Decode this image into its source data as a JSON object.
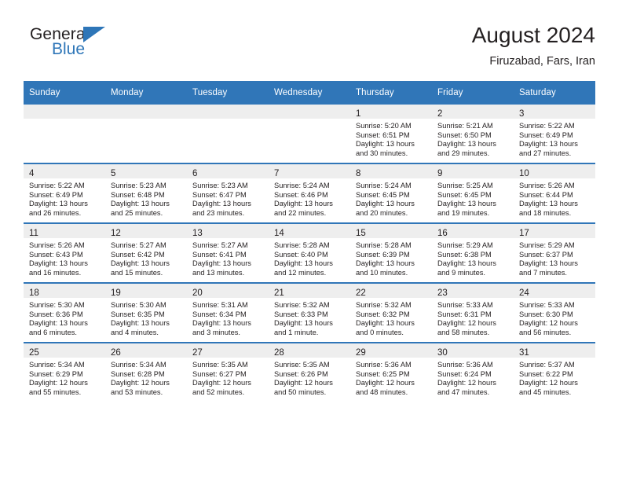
{
  "brand": {
    "word_one": "General",
    "word_two": "Blue",
    "flag_icon": "triangle-flag-icon"
  },
  "header": {
    "month_title": "August 2024",
    "location": "Firuzabad, Fars, Iran"
  },
  "colors": {
    "header_blue": "#3076b8",
    "brand_blue": "#2e76b8",
    "daynum_strip": "#eeeeee",
    "text": "#231f20"
  },
  "calendar": {
    "weekday_headers": [
      "Sunday",
      "Monday",
      "Tuesday",
      "Wednesday",
      "Thursday",
      "Friday",
      "Saturday"
    ],
    "weeks": [
      [
        {
          "day": "",
          "sunrise": "",
          "sunset": "",
          "daylight_line1": "",
          "daylight_line2": ""
        },
        {
          "day": "",
          "sunrise": "",
          "sunset": "",
          "daylight_line1": "",
          "daylight_line2": ""
        },
        {
          "day": "",
          "sunrise": "",
          "sunset": "",
          "daylight_line1": "",
          "daylight_line2": ""
        },
        {
          "day": "",
          "sunrise": "",
          "sunset": "",
          "daylight_line1": "",
          "daylight_line2": ""
        },
        {
          "day": "1",
          "sunrise": "Sunrise: 5:20 AM",
          "sunset": "Sunset: 6:51 PM",
          "daylight_line1": "Daylight: 13 hours",
          "daylight_line2": "and 30 minutes."
        },
        {
          "day": "2",
          "sunrise": "Sunrise: 5:21 AM",
          "sunset": "Sunset: 6:50 PM",
          "daylight_line1": "Daylight: 13 hours",
          "daylight_line2": "and 29 minutes."
        },
        {
          "day": "3",
          "sunrise": "Sunrise: 5:22 AM",
          "sunset": "Sunset: 6:49 PM",
          "daylight_line1": "Daylight: 13 hours",
          "daylight_line2": "and 27 minutes."
        }
      ],
      [
        {
          "day": "4",
          "sunrise": "Sunrise: 5:22 AM",
          "sunset": "Sunset: 6:49 PM",
          "daylight_line1": "Daylight: 13 hours",
          "daylight_line2": "and 26 minutes."
        },
        {
          "day": "5",
          "sunrise": "Sunrise: 5:23 AM",
          "sunset": "Sunset: 6:48 PM",
          "daylight_line1": "Daylight: 13 hours",
          "daylight_line2": "and 25 minutes."
        },
        {
          "day": "6",
          "sunrise": "Sunrise: 5:23 AM",
          "sunset": "Sunset: 6:47 PM",
          "daylight_line1": "Daylight: 13 hours",
          "daylight_line2": "and 23 minutes."
        },
        {
          "day": "7",
          "sunrise": "Sunrise: 5:24 AM",
          "sunset": "Sunset: 6:46 PM",
          "daylight_line1": "Daylight: 13 hours",
          "daylight_line2": "and 22 minutes."
        },
        {
          "day": "8",
          "sunrise": "Sunrise: 5:24 AM",
          "sunset": "Sunset: 6:45 PM",
          "daylight_line1": "Daylight: 13 hours",
          "daylight_line2": "and 20 minutes."
        },
        {
          "day": "9",
          "sunrise": "Sunrise: 5:25 AM",
          "sunset": "Sunset: 6:45 PM",
          "daylight_line1": "Daylight: 13 hours",
          "daylight_line2": "and 19 minutes."
        },
        {
          "day": "10",
          "sunrise": "Sunrise: 5:26 AM",
          "sunset": "Sunset: 6:44 PM",
          "daylight_line1": "Daylight: 13 hours",
          "daylight_line2": "and 18 minutes."
        }
      ],
      [
        {
          "day": "11",
          "sunrise": "Sunrise: 5:26 AM",
          "sunset": "Sunset: 6:43 PM",
          "daylight_line1": "Daylight: 13 hours",
          "daylight_line2": "and 16 minutes."
        },
        {
          "day": "12",
          "sunrise": "Sunrise: 5:27 AM",
          "sunset": "Sunset: 6:42 PM",
          "daylight_line1": "Daylight: 13 hours",
          "daylight_line2": "and 15 minutes."
        },
        {
          "day": "13",
          "sunrise": "Sunrise: 5:27 AM",
          "sunset": "Sunset: 6:41 PM",
          "daylight_line1": "Daylight: 13 hours",
          "daylight_line2": "and 13 minutes."
        },
        {
          "day": "14",
          "sunrise": "Sunrise: 5:28 AM",
          "sunset": "Sunset: 6:40 PM",
          "daylight_line1": "Daylight: 13 hours",
          "daylight_line2": "and 12 minutes."
        },
        {
          "day": "15",
          "sunrise": "Sunrise: 5:28 AM",
          "sunset": "Sunset: 6:39 PM",
          "daylight_line1": "Daylight: 13 hours",
          "daylight_line2": "and 10 minutes."
        },
        {
          "day": "16",
          "sunrise": "Sunrise: 5:29 AM",
          "sunset": "Sunset: 6:38 PM",
          "daylight_line1": "Daylight: 13 hours",
          "daylight_line2": "and 9 minutes."
        },
        {
          "day": "17",
          "sunrise": "Sunrise: 5:29 AM",
          "sunset": "Sunset: 6:37 PM",
          "daylight_line1": "Daylight: 13 hours",
          "daylight_line2": "and 7 minutes."
        }
      ],
      [
        {
          "day": "18",
          "sunrise": "Sunrise: 5:30 AM",
          "sunset": "Sunset: 6:36 PM",
          "daylight_line1": "Daylight: 13 hours",
          "daylight_line2": "and 6 minutes."
        },
        {
          "day": "19",
          "sunrise": "Sunrise: 5:30 AM",
          "sunset": "Sunset: 6:35 PM",
          "daylight_line1": "Daylight: 13 hours",
          "daylight_line2": "and 4 minutes."
        },
        {
          "day": "20",
          "sunrise": "Sunrise: 5:31 AM",
          "sunset": "Sunset: 6:34 PM",
          "daylight_line1": "Daylight: 13 hours",
          "daylight_line2": "and 3 minutes."
        },
        {
          "day": "21",
          "sunrise": "Sunrise: 5:32 AM",
          "sunset": "Sunset: 6:33 PM",
          "daylight_line1": "Daylight: 13 hours",
          "daylight_line2": "and 1 minute."
        },
        {
          "day": "22",
          "sunrise": "Sunrise: 5:32 AM",
          "sunset": "Sunset: 6:32 PM",
          "daylight_line1": "Daylight: 13 hours",
          "daylight_line2": "and 0 minutes."
        },
        {
          "day": "23",
          "sunrise": "Sunrise: 5:33 AM",
          "sunset": "Sunset: 6:31 PM",
          "daylight_line1": "Daylight: 12 hours",
          "daylight_line2": "and 58 minutes."
        },
        {
          "day": "24",
          "sunrise": "Sunrise: 5:33 AM",
          "sunset": "Sunset: 6:30 PM",
          "daylight_line1": "Daylight: 12 hours",
          "daylight_line2": "and 56 minutes."
        }
      ],
      [
        {
          "day": "25",
          "sunrise": "Sunrise: 5:34 AM",
          "sunset": "Sunset: 6:29 PM",
          "daylight_line1": "Daylight: 12 hours",
          "daylight_line2": "and 55 minutes."
        },
        {
          "day": "26",
          "sunrise": "Sunrise: 5:34 AM",
          "sunset": "Sunset: 6:28 PM",
          "daylight_line1": "Daylight: 12 hours",
          "daylight_line2": "and 53 minutes."
        },
        {
          "day": "27",
          "sunrise": "Sunrise: 5:35 AM",
          "sunset": "Sunset: 6:27 PM",
          "daylight_line1": "Daylight: 12 hours",
          "daylight_line2": "and 52 minutes."
        },
        {
          "day": "28",
          "sunrise": "Sunrise: 5:35 AM",
          "sunset": "Sunset: 6:26 PM",
          "daylight_line1": "Daylight: 12 hours",
          "daylight_line2": "and 50 minutes."
        },
        {
          "day": "29",
          "sunrise": "Sunrise: 5:36 AM",
          "sunset": "Sunset: 6:25 PM",
          "daylight_line1": "Daylight: 12 hours",
          "daylight_line2": "and 48 minutes."
        },
        {
          "day": "30",
          "sunrise": "Sunrise: 5:36 AM",
          "sunset": "Sunset: 6:24 PM",
          "daylight_line1": "Daylight: 12 hours",
          "daylight_line2": "and 47 minutes."
        },
        {
          "day": "31",
          "sunrise": "Sunrise: 5:37 AM",
          "sunset": "Sunset: 6:22 PM",
          "daylight_line1": "Daylight: 12 hours",
          "daylight_line2": "and 45 minutes."
        }
      ]
    ]
  }
}
